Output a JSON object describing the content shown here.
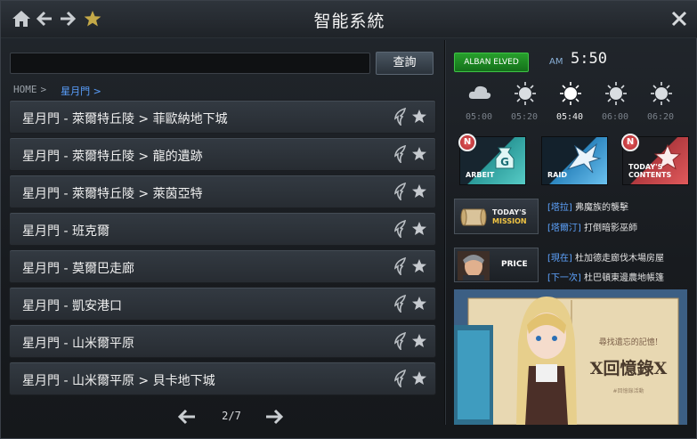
{
  "app": {
    "title": "智能系統"
  },
  "icons": {
    "home": "home-icon",
    "back": "arrow-left-icon",
    "forward": "arrow-right-icon",
    "favorite": "star-icon",
    "close": "close-icon",
    "wing": "wing-icon",
    "rowStar": "star-icon"
  },
  "search": {
    "value": "",
    "placeholder": "",
    "button": "查詢"
  },
  "breadcrumb": {
    "home": "HOME",
    "sep": ">",
    "current": "星月門 >"
  },
  "list": [
    {
      "label": "星月門 - 萊爾特丘陵 > 菲歐納地下城"
    },
    {
      "label": "星月門 - 萊爾特丘陵 > 龍的遺跡"
    },
    {
      "label": "星月門 - 萊爾特丘陵 > 萊茵亞特"
    },
    {
      "label": "星月門 - 班克爾"
    },
    {
      "label": "星月門 - 莫爾巴走廊"
    },
    {
      "label": "星月門 - 凱安港口"
    },
    {
      "label": "星月門 - 山米爾平原"
    },
    {
      "label": "星月門 - 山米爾平原 > 貝卡地下城"
    }
  ],
  "pager": {
    "text": "2/7",
    "current": 2,
    "total": 7
  },
  "server": {
    "label": "ALBAN ELVED"
  },
  "clock": {
    "ampm": "AM",
    "time": "5:50"
  },
  "weather": [
    {
      "time": "05:00",
      "icon": "cloud-icon",
      "active": false
    },
    {
      "time": "05:20",
      "icon": "sun-icon",
      "active": false
    },
    {
      "time": "05:40",
      "icon": "sun-icon",
      "active": true
    },
    {
      "time": "06:00",
      "icon": "sun-icon",
      "active": false
    },
    {
      "time": "06:20",
      "icon": "sun-icon",
      "active": false
    }
  ],
  "quick": {
    "arbeit": {
      "label": "ARBEIT",
      "badge": "N",
      "glyph": "G"
    },
    "raid": {
      "label": "RAID"
    },
    "today": {
      "label1": "TODAY'S",
      "label2": "CONTENTS",
      "badge": "N"
    }
  },
  "mission": {
    "card1": "TODAY'S",
    "card2": "MISSION",
    "lines": [
      {
        "tag": "[塔拉]",
        "text": " 弗魔族的襲擊"
      },
      {
        "tag": "[塔爾汀]",
        "text": " 打倒暗影巫師"
      }
    ]
  },
  "price": {
    "label": "PRICE",
    "lines": [
      {
        "tag": "[現在]",
        "text": " 杜加德走廊伐木場房屋"
      },
      {
        "tag": "[下一次]",
        "text": " 杜巴頓東邊農地帳篷"
      }
    ]
  },
  "banner": {
    "title": "X回憶錄X",
    "subtitle": "尋找遺忘的記憶!",
    "small": "#回憶錄活動"
  },
  "colors": {
    "accent": "#5aa0ff",
    "server": "#1e8a24",
    "badge": "#c73a3e",
    "mission": "#f0c443"
  }
}
